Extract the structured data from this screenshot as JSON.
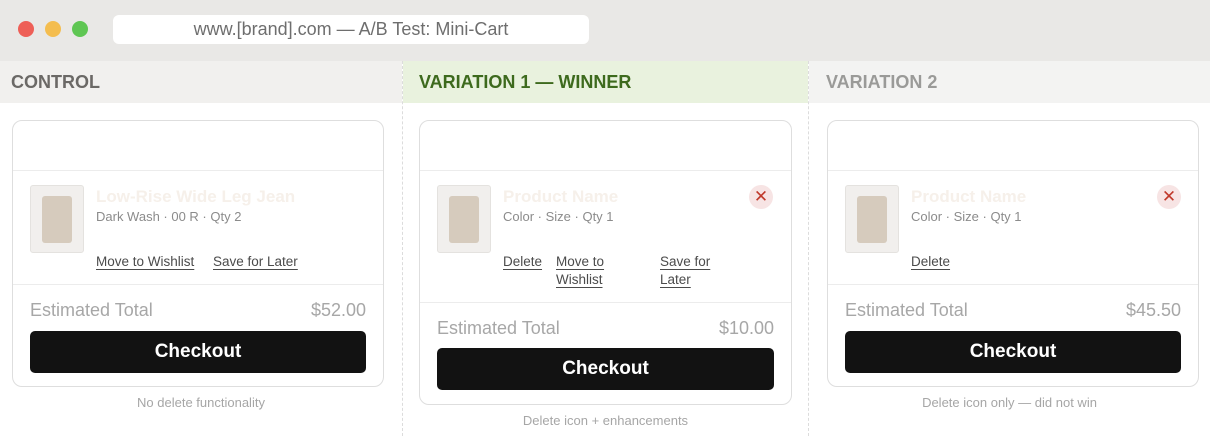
{
  "browser": {
    "url": "www.[brand].com — A/B Test: Mini-Cart"
  },
  "control": {
    "header": "CONTROL",
    "product_name": "Low-Rise Wide Leg Jean",
    "product_meta": "Dark Wash · 00 R · Qty 2",
    "actions": [
      "Move to Wishlist",
      "Save for Later"
    ],
    "total_label": "Estimated Total",
    "total_value": "$52.00",
    "checkout_label": "Checkout",
    "caption": "No delete functionality"
  },
  "variation1": {
    "header": "VARIATION 1 — WINNER",
    "product_name": "Product Name",
    "product_meta": "Color · Size · Qty 1",
    "remove_icon": "close-x",
    "actions": [
      "Delete",
      "Move to Wishlist",
      "Save for Later"
    ],
    "total_label": "Estimated Total",
    "total_value": "$10.00",
    "checkout_label": "Checkout",
    "caption": "Delete icon + enhancements"
  },
  "variation2": {
    "header": "VARIATION 2",
    "product_name": "Product Name",
    "product_meta": "Color · Size · Qty 1",
    "remove_icon": "close-x",
    "actions": [
      "Delete"
    ],
    "total_label": "Estimated Total",
    "total_value": "$45.50",
    "checkout_label": "Checkout",
    "caption": "Delete icon only — did not win"
  },
  "colors": {
    "winner_header_bg": "#e9f2de",
    "winner_header_text": "#3d6a1d",
    "checkout_bg": "#121212",
    "remove_icon_bg": "#f7e4e4",
    "remove_icon_fg": "#c0392b"
  }
}
